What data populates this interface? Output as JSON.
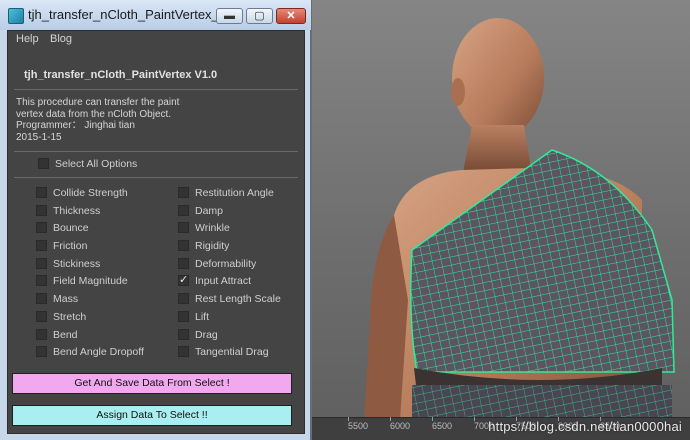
{
  "window": {
    "title": "tjh_transfer_nCloth_PaintVertex_t...",
    "controls": {
      "minimize": "▬",
      "maximize": "▢",
      "close": "✕"
    }
  },
  "menu": [
    "Help",
    "Blog"
  ],
  "heading": "tjh_transfer_nCloth_PaintVertex V1.0",
  "description": [
    "This procedure can  transfer the paint",
    "vertex  data from the nCloth Object.",
    "Programmer： Jinghai tian",
    "2015-1-15"
  ],
  "select_all": {
    "label": "Select All Options",
    "checked": false
  },
  "options_left": [
    {
      "label": "Collide Strength",
      "checked": false
    },
    {
      "label": "Thickness",
      "checked": false
    },
    {
      "label": "Bounce",
      "checked": false
    },
    {
      "label": "Friction",
      "checked": false
    },
    {
      "label": "Stickiness",
      "checked": false
    },
    {
      "label": "Field Magnitude",
      "checked": false
    },
    {
      "label": "Mass",
      "checked": false
    },
    {
      "label": "Stretch",
      "checked": false
    },
    {
      "label": "Bend",
      "checked": false
    },
    {
      "label": "Bend Angle Dropoff",
      "checked": false
    }
  ],
  "options_right": [
    {
      "label": "Restitution Angle",
      "checked": false
    },
    {
      "label": "Damp",
      "checked": false
    },
    {
      "label": "Wrinkle",
      "checked": false
    },
    {
      "label": "Rigidity",
      "checked": false
    },
    {
      "label": "Deformability",
      "checked": false
    },
    {
      "label": "Input Attract",
      "checked": true
    },
    {
      "label": "Rest Length Scale",
      "checked": false
    },
    {
      "label": "Lift",
      "checked": false
    },
    {
      "label": "Drag",
      "checked": false
    },
    {
      "label": "Tangential Drag",
      "checked": false
    }
  ],
  "buttons": {
    "save": "Get And Save Data From Select !",
    "assign": "Assign Data To Select !!"
  },
  "viewport": {
    "ruler_ticks": [
      "5500",
      "6000",
      "6500",
      "7000",
      "7500",
      "8000",
      "8500"
    ],
    "watermark": "https://blog.csdn.net/tian0000hai",
    "mesh_color": "#33e89a"
  },
  "colors": {
    "save_button": "#f2a8ef",
    "assign_button": "#a9eef0",
    "panel_bg": "#444444"
  }
}
